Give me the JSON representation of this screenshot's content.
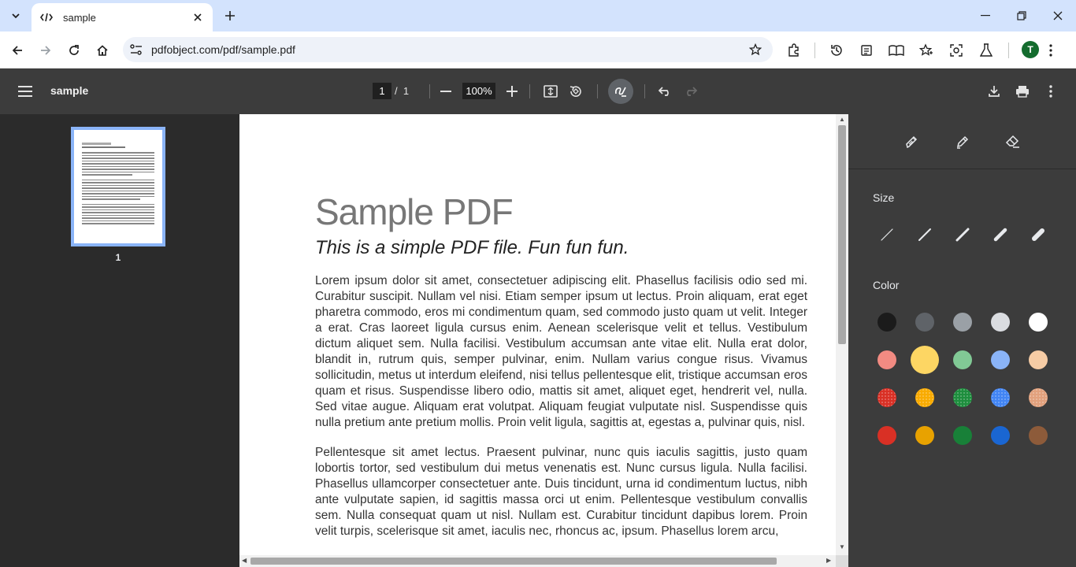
{
  "browser": {
    "tab_title": "sample",
    "url": "pdfobject.com/pdf/sample.pdf",
    "profile_initial": "T"
  },
  "viewer": {
    "doc_title": "sample",
    "current_page": "1",
    "page_separator": "/",
    "total_pages": "1",
    "zoom": "100%"
  },
  "thumbnails": [
    {
      "label": "1"
    }
  ],
  "document": {
    "heading": "Sample PDF",
    "subtitle": "This is a simple PDF file. Fun fun fun.",
    "paragraph1": "Lorem ipsum dolor sit amet, consectetuer adipiscing elit. Phasellus facilisis odio sed mi. Curabitur suscipit. Nullam vel nisi. Etiam semper ipsum ut lectus. Proin aliquam, erat eget pharetra commodo, eros mi condimentum quam, sed commodo justo quam ut velit. Integer a erat. Cras laoreet ligula cursus enim. Aenean scelerisque velit et tellus. Vestibulum dictum aliquet sem. Nulla facilisi. Vestibulum accumsan ante vitae elit. Nulla erat dolor, blandit in, rutrum quis, semper pulvinar, enim. Nullam varius congue risus. Vivamus sollicitudin, metus ut interdum eleifend, nisi tellus pellentesque elit, tristique accumsan eros quam et risus. Suspendisse libero odio, mattis sit amet, aliquet eget, hendrerit vel, nulla. Sed vitae augue. Aliquam erat volutpat. Aliquam feugiat vulputate nisl. Suspendisse quis nulla pretium ante pretium mollis. Proin velit ligula, sagittis at, egestas a, pulvinar quis, nisl.",
    "paragraph2": "Pellentesque sit amet lectus. Praesent pulvinar, nunc quis iaculis sagittis, justo quam lobortis tortor, sed vestibulum dui metus venenatis est. Nunc cursus ligula. Nulla facilisi. Phasellus ullamcorper consectetuer ante. Duis tincidunt, urna id condimentum luctus, nibh ante vulputate sapien, id sagittis massa orci ut enim. Pellentesque vestibulum convallis sem. Nulla consequat quam ut nisl. Nullam est. Curabitur tincidunt dapibus lorem. Proin velit turpis, scelerisque sit amet, iaculis nec, rhoncus ac, ipsum. Phasellus lorem arcu,"
  },
  "annotation_panel": {
    "size_label": "Size",
    "color_label": "Color",
    "colors": [
      [
        "#1b1b1b",
        "#5f6368",
        "#9aa0a6",
        "#dadce0",
        "#ffffff"
      ],
      [
        "#f28b82",
        "#fdd663",
        "#81c995",
        "#8ab4f8",
        "#f6cca5"
      ],
      [
        "#d93025",
        "#f9ab00",
        "#1e8e3e",
        "#4285f4",
        "#e2a17d"
      ],
      [
        "#d93025",
        "#e8a200",
        "#188038",
        "#1a66d2",
        "#8d5b3a"
      ]
    ],
    "selected_color": "#fdd663"
  }
}
